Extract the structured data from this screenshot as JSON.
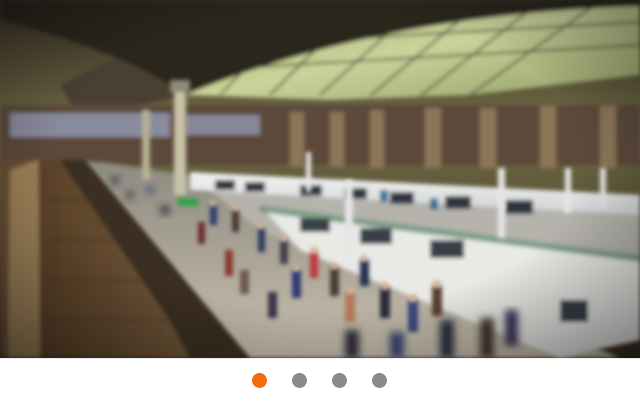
{
  "carousel": {
    "slides": [
      {
        "image": "train-station-crowd-tilt-shift",
        "selected": true
      },
      {
        "image": "",
        "selected": false
      },
      {
        "image": "",
        "selected": false
      },
      {
        "image": "",
        "selected": false
      }
    ],
    "active_index": 0,
    "colors": {
      "active_dot": "#f26b0f",
      "inactive_dot": "#8a8a8a",
      "bar_background": "#ffffff"
    }
  }
}
